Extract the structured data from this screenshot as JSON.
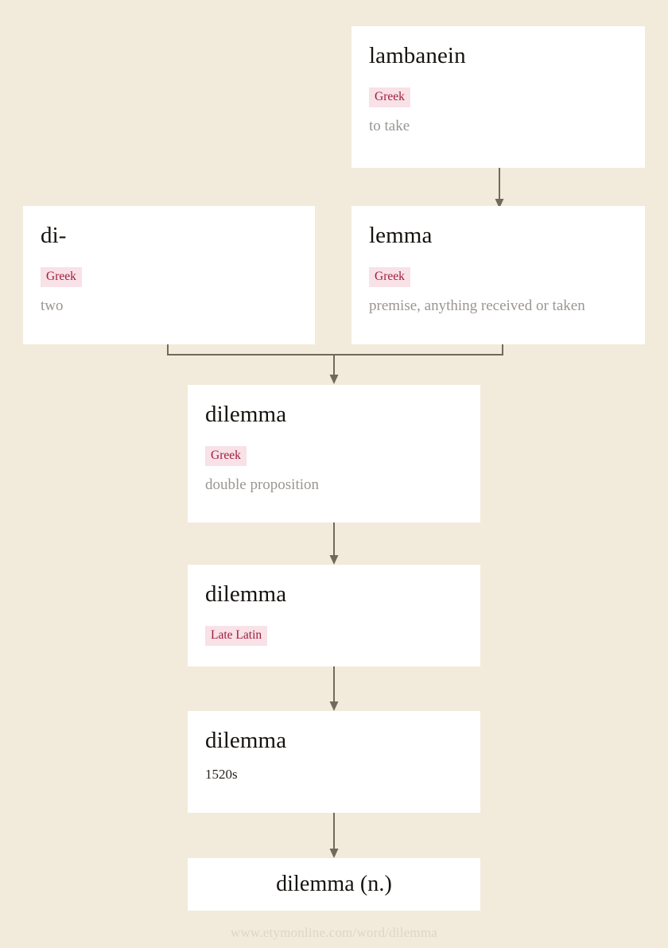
{
  "page": {
    "background_color": "#f2ebdb",
    "card_color": "#ffffff",
    "badge_bg_color": "#f8e1e7",
    "badge_text_color": "#9e1f3d",
    "gloss_color": "#9a9691",
    "connector_color": "#6f6a5c",
    "footer_text": "www.etymonline.com/word/dilemma",
    "footer_color": "#ded6c4"
  },
  "nodes": {
    "lambanein": {
      "headword": "lambanein",
      "language": "Greek",
      "gloss": "to take"
    },
    "di": {
      "headword": "di-",
      "language": "Greek",
      "gloss": "two"
    },
    "lemma": {
      "headword": "lemma",
      "language": "Greek",
      "gloss": "premise, anything received or taken"
    },
    "dilemma_greek": {
      "headword": "dilemma",
      "language": "Greek",
      "gloss": "double proposition"
    },
    "dilemma_late_latin": {
      "headword": "dilemma",
      "language": "Late Latin"
    },
    "dilemma_1520s": {
      "headword": "dilemma",
      "date": "1520s"
    },
    "dilemma_entry": {
      "headword": "dilemma (n.)"
    }
  },
  "edges": [
    {
      "from": "lambanein",
      "to": "lemma",
      "type": "straight-down"
    },
    {
      "from": "di-",
      "to": "dilemma (Greek)",
      "type": "merge-left"
    },
    {
      "from": "lemma",
      "to": "dilemma (Greek)",
      "type": "merge-right"
    },
    {
      "from": "dilemma (Greek)",
      "to": "dilemma (Late Latin)",
      "type": "straight-down"
    },
    {
      "from": "dilemma (Late Latin)",
      "to": "dilemma (1520s)",
      "type": "straight-down"
    },
    {
      "from": "dilemma (1520s)",
      "to": "dilemma (n.)",
      "type": "straight-down"
    }
  ]
}
